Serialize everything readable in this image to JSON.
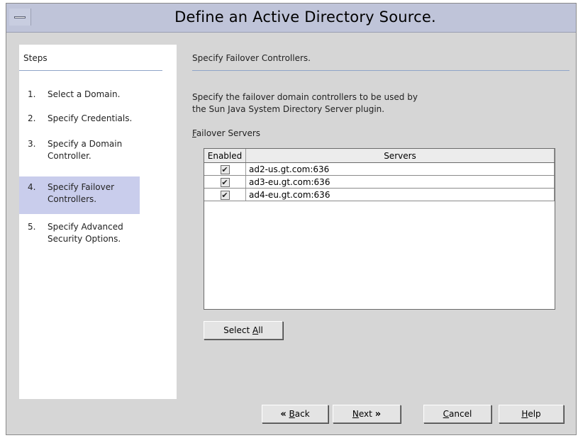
{
  "window": {
    "title": "Define an Active Directory Source."
  },
  "steps": {
    "header": "Steps",
    "items": [
      {
        "num": "1.",
        "label": "Select a Domain."
      },
      {
        "num": "2.",
        "label": "Specify Credentials."
      },
      {
        "num": "3.",
        "label": "Specify a Domain Controller."
      },
      {
        "num": "4.",
        "label": "Specify Failover Controllers."
      },
      {
        "num": "5.",
        "label": "Specify Advanced Security Options."
      }
    ]
  },
  "main": {
    "header": "Specify Failover Controllers.",
    "description_line1": "Specify the failover domain controllers to be used by",
    "description_line2": "the Sun Java System Directory Server plugin.",
    "list_label_mnemonic": "F",
    "list_label_rest": "ailover Servers",
    "table": {
      "columns": [
        "Enabled",
        "Servers"
      ],
      "rows": [
        {
          "enabled": "✔",
          "server": "ad2-us.gt.com:636"
        },
        {
          "enabled": "✔",
          "server": "ad3-eu.gt.com:636"
        },
        {
          "enabled": "✔",
          "server": "ad4-eu.gt.com:636"
        }
      ]
    },
    "select_all": {
      "prefix": "Select ",
      "mnemonic": "A",
      "suffix": "ll"
    }
  },
  "buttons": {
    "back": {
      "chevron": "«",
      "mnemonic": "B",
      "rest": "ack"
    },
    "next": {
      "mnemonic": "N",
      "rest": "ext",
      "chevron": "»"
    },
    "cancel": {
      "mnemonic": "C",
      "rest": "ancel"
    },
    "help": {
      "mnemonic": "H",
      "rest": "elp"
    }
  }
}
